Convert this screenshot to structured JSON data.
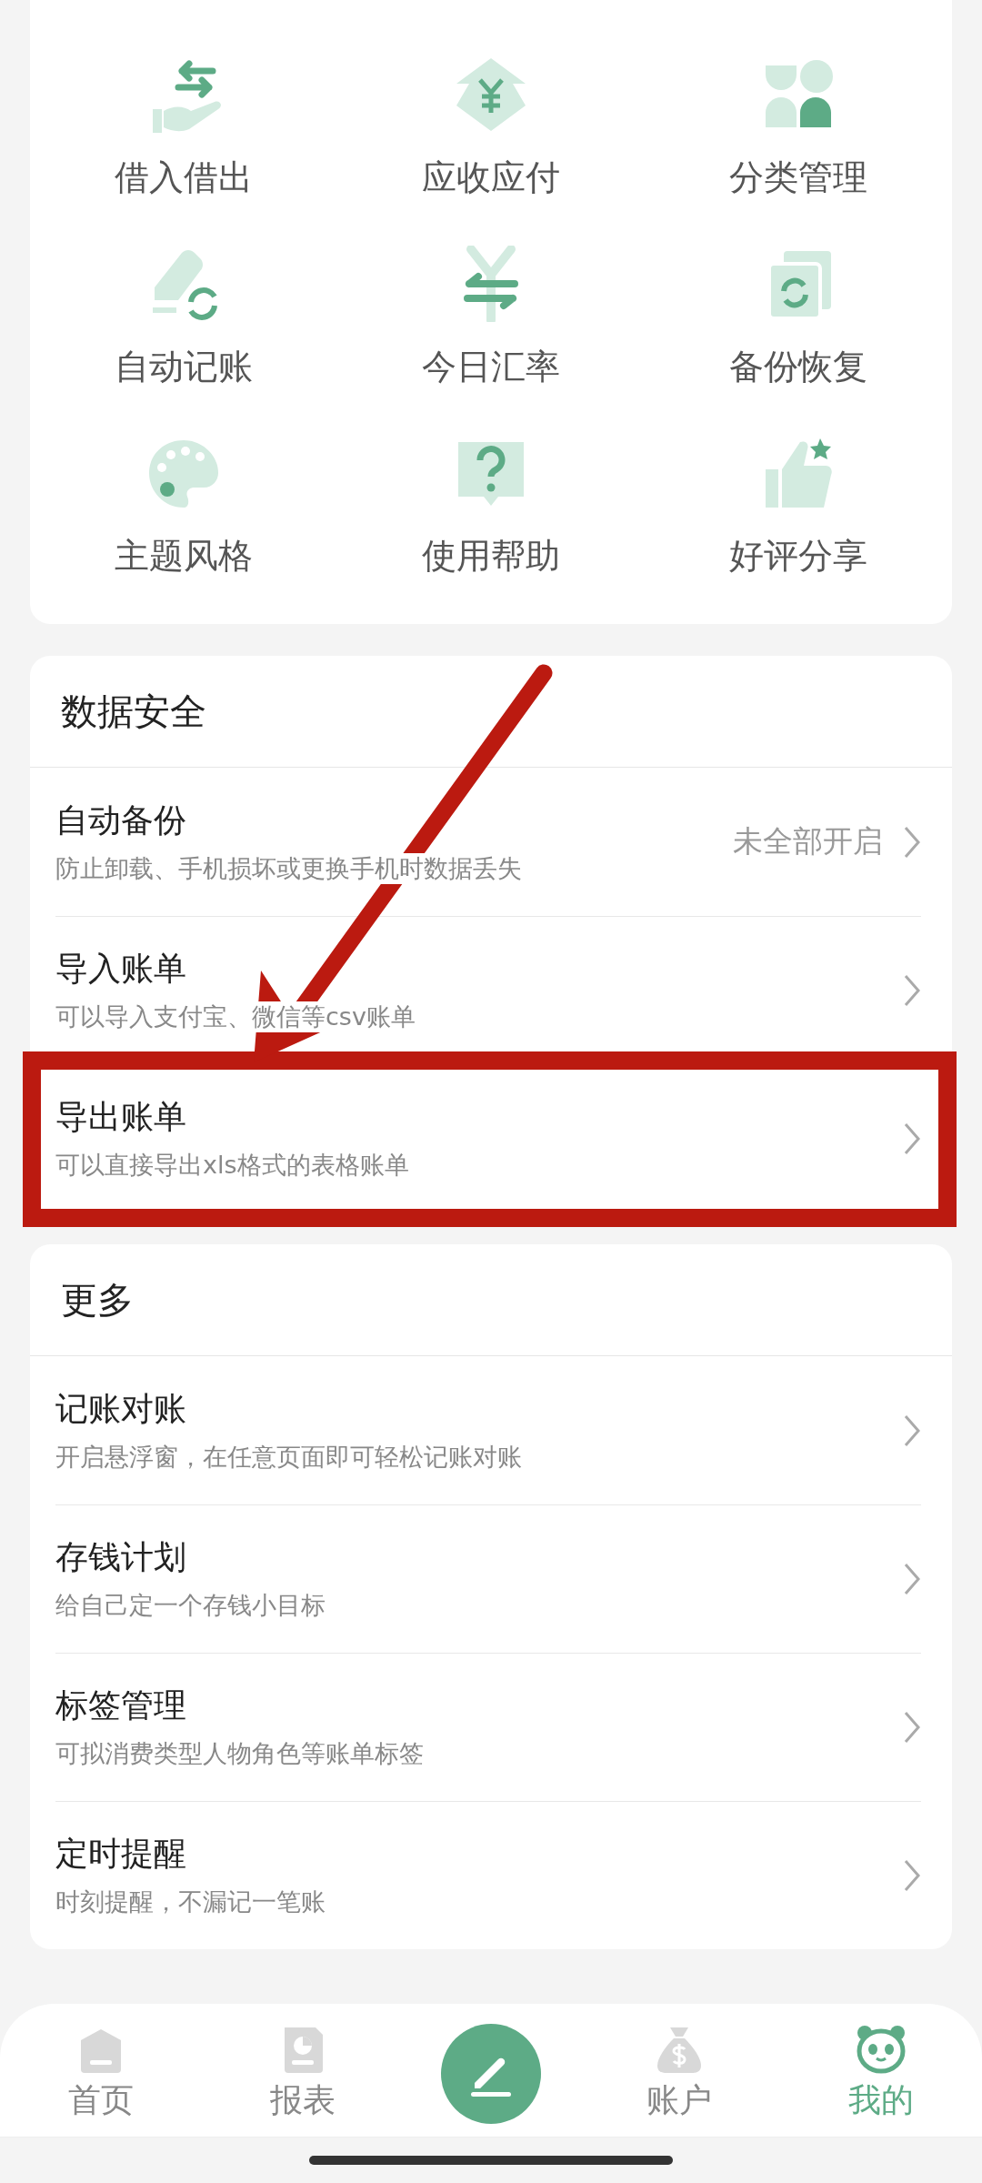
{
  "tools": [
    {
      "label": "借入借出"
    },
    {
      "label": "应收应付"
    },
    {
      "label": "分类管理"
    },
    {
      "label": "自动记账"
    },
    {
      "label": "今日汇率"
    },
    {
      "label": "备份恢复"
    },
    {
      "label": "主题风格"
    },
    {
      "label": "使用帮助"
    },
    {
      "label": "好评分享"
    }
  ],
  "sections": [
    {
      "title": "数据安全",
      "rows": [
        {
          "title": "自动备份",
          "subtitle": "防止卸载、手机损坏或更换手机时数据丢失",
          "value": "未全部开启",
          "highlighted": false
        },
        {
          "title": "导入账单",
          "subtitle": "可以导入支付宝、微信等csv账单",
          "highlighted": false
        },
        {
          "title": "导出账单",
          "subtitle": "可以直接导出xls格式的表格账单",
          "highlighted": true
        }
      ]
    },
    {
      "title": "更多",
      "rows": [
        {
          "title": "记账对账",
          "subtitle": "开启悬浮窗，在任意页面即可轻松记账对账",
          "highlighted": false
        },
        {
          "title": "存钱计划",
          "subtitle": "给自己定一个存钱小目标",
          "highlighted": false
        },
        {
          "title": "标签管理",
          "subtitle": "可拟消费类型人物角色等账单标签",
          "highlighted": false
        },
        {
          "title": "定时提醒",
          "subtitle": "时刻提醒，不漏记一笔账",
          "highlighted": false
        }
      ]
    }
  ],
  "annotations": [
    {
      "kind": "arrow"
    }
  ],
  "tab_bar": [
    {
      "kind": "tab",
      "label": "首页",
      "selected": false
    },
    {
      "kind": "tab",
      "label": "报表",
      "selected": false
    },
    {
      "kind": "action"
    },
    {
      "kind": "tab",
      "label": "账户",
      "selected": false
    },
    {
      "kind": "tab",
      "label": "我的",
      "selected": true
    }
  ]
}
